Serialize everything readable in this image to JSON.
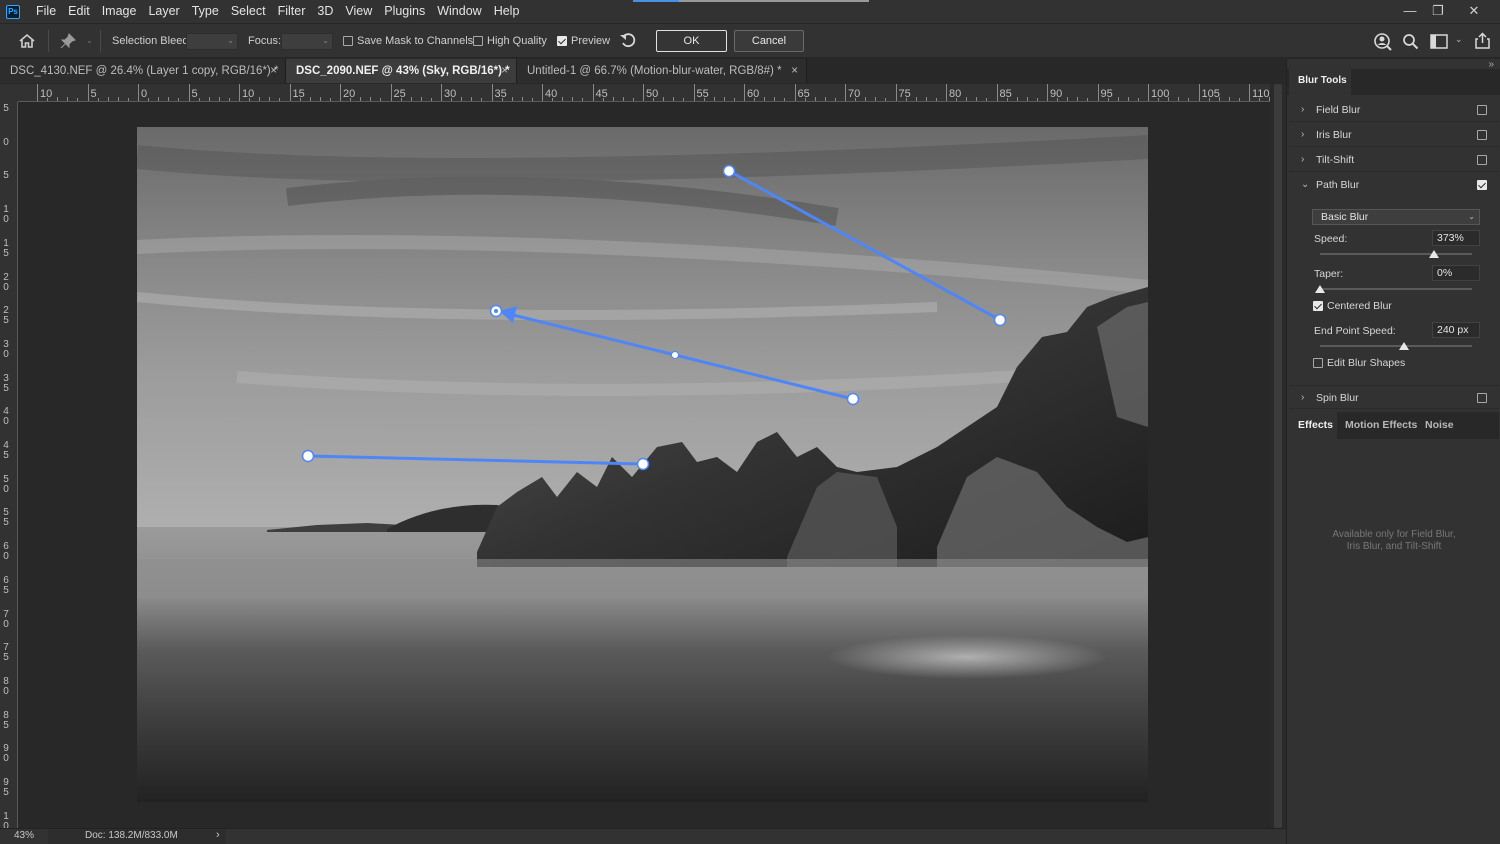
{
  "app": {
    "logo": "Ps"
  },
  "menu": [
    "File",
    "Edit",
    "Image",
    "Layer",
    "Type",
    "Select",
    "Filter",
    "3D",
    "View",
    "Plugins",
    "Window",
    "Help"
  ],
  "window_controls": {
    "minimize": "—",
    "restore": "❐",
    "close": "✕"
  },
  "options": {
    "home_icon": "home-icon",
    "pin_icon": "pin-icon",
    "selection_bleed_label": "Selection Bleed:",
    "selection_bleed_value": "",
    "focus_label": "Focus:",
    "focus_value": "",
    "save_mask_label": "Save Mask to Channels",
    "save_mask_checked": false,
    "high_quality_label": "High Quality",
    "high_quality_checked": false,
    "preview_label": "Preview",
    "preview_checked": true,
    "reset_icon": "undo-icon",
    "ok_label": "OK",
    "cancel_label": "Cancel",
    "right_icons": [
      "user-search-icon",
      "search-icon",
      "workspace-icon",
      "share-icon"
    ]
  },
  "tabs": [
    {
      "label": "DSC_4130.NEF @ 26.4% (Layer 1 copy, RGB/16*) *",
      "active": false
    },
    {
      "label": "DSC_2090.NEF @ 43% (Sky, RGB/16*) *",
      "active": true
    },
    {
      "label": "Untitled-1 @ 66.7% (Motion-blur-water, RGB/8#) *",
      "active": false
    }
  ],
  "tab_close": "×",
  "ruler_top": [
    "10",
    "5",
    "0",
    "5",
    "10",
    "15",
    "20",
    "25",
    "30",
    "35",
    "40",
    "45",
    "50",
    "55",
    "60",
    "65",
    "70",
    "75",
    "80",
    "85",
    "90",
    "95",
    "100",
    "105",
    "110"
  ],
  "ruler_left": [
    "5",
    "0",
    "5",
    "10",
    "15",
    "20",
    "25",
    "30",
    "35",
    "40",
    "45",
    "50",
    "55",
    "60",
    "65",
    "70",
    "75",
    "80",
    "85",
    "90",
    "95",
    "10"
  ],
  "status": {
    "zoom": "43%",
    "doc": "Doc: 138.2M/833.0M",
    "arrow": "›"
  },
  "panel": {
    "collapse": "»",
    "title": "Blur Tools",
    "blur_items": [
      {
        "label": "Field Blur",
        "expanded": false,
        "checked": false
      },
      {
        "label": "Iris Blur",
        "expanded": false,
        "checked": false
      },
      {
        "label": "Tilt-Shift",
        "expanded": false,
        "checked": false
      },
      {
        "label": "Path Blur",
        "expanded": true,
        "checked": true
      }
    ],
    "path_blur": {
      "mode": "Basic Blur",
      "speed_label": "Speed:",
      "speed_value": "373%",
      "speed_level": 0.75,
      "taper_label": "Taper:",
      "taper_value": "0%",
      "taper_level": 0.0,
      "centered_label": "Centered Blur",
      "centered_checked": true,
      "end_speed_label": "End Point Speed:",
      "end_speed_value": "240 px",
      "end_speed_level": 0.55,
      "edit_shapes_label": "Edit Blur Shapes",
      "edit_shapes_checked": false
    },
    "spin_blur": {
      "label": "Spin Blur",
      "checked": false
    },
    "effects_tabs": [
      "Effects",
      "Motion Effects",
      "Noise"
    ],
    "effects_note_line1": "Available only for Field Blur,",
    "effects_note_line2": "Iris Blur, and Tilt-Shift"
  },
  "colors": {
    "accent": "#4f86f7",
    "panel_bg": "#323232",
    "canvas_bg": "#282828"
  }
}
